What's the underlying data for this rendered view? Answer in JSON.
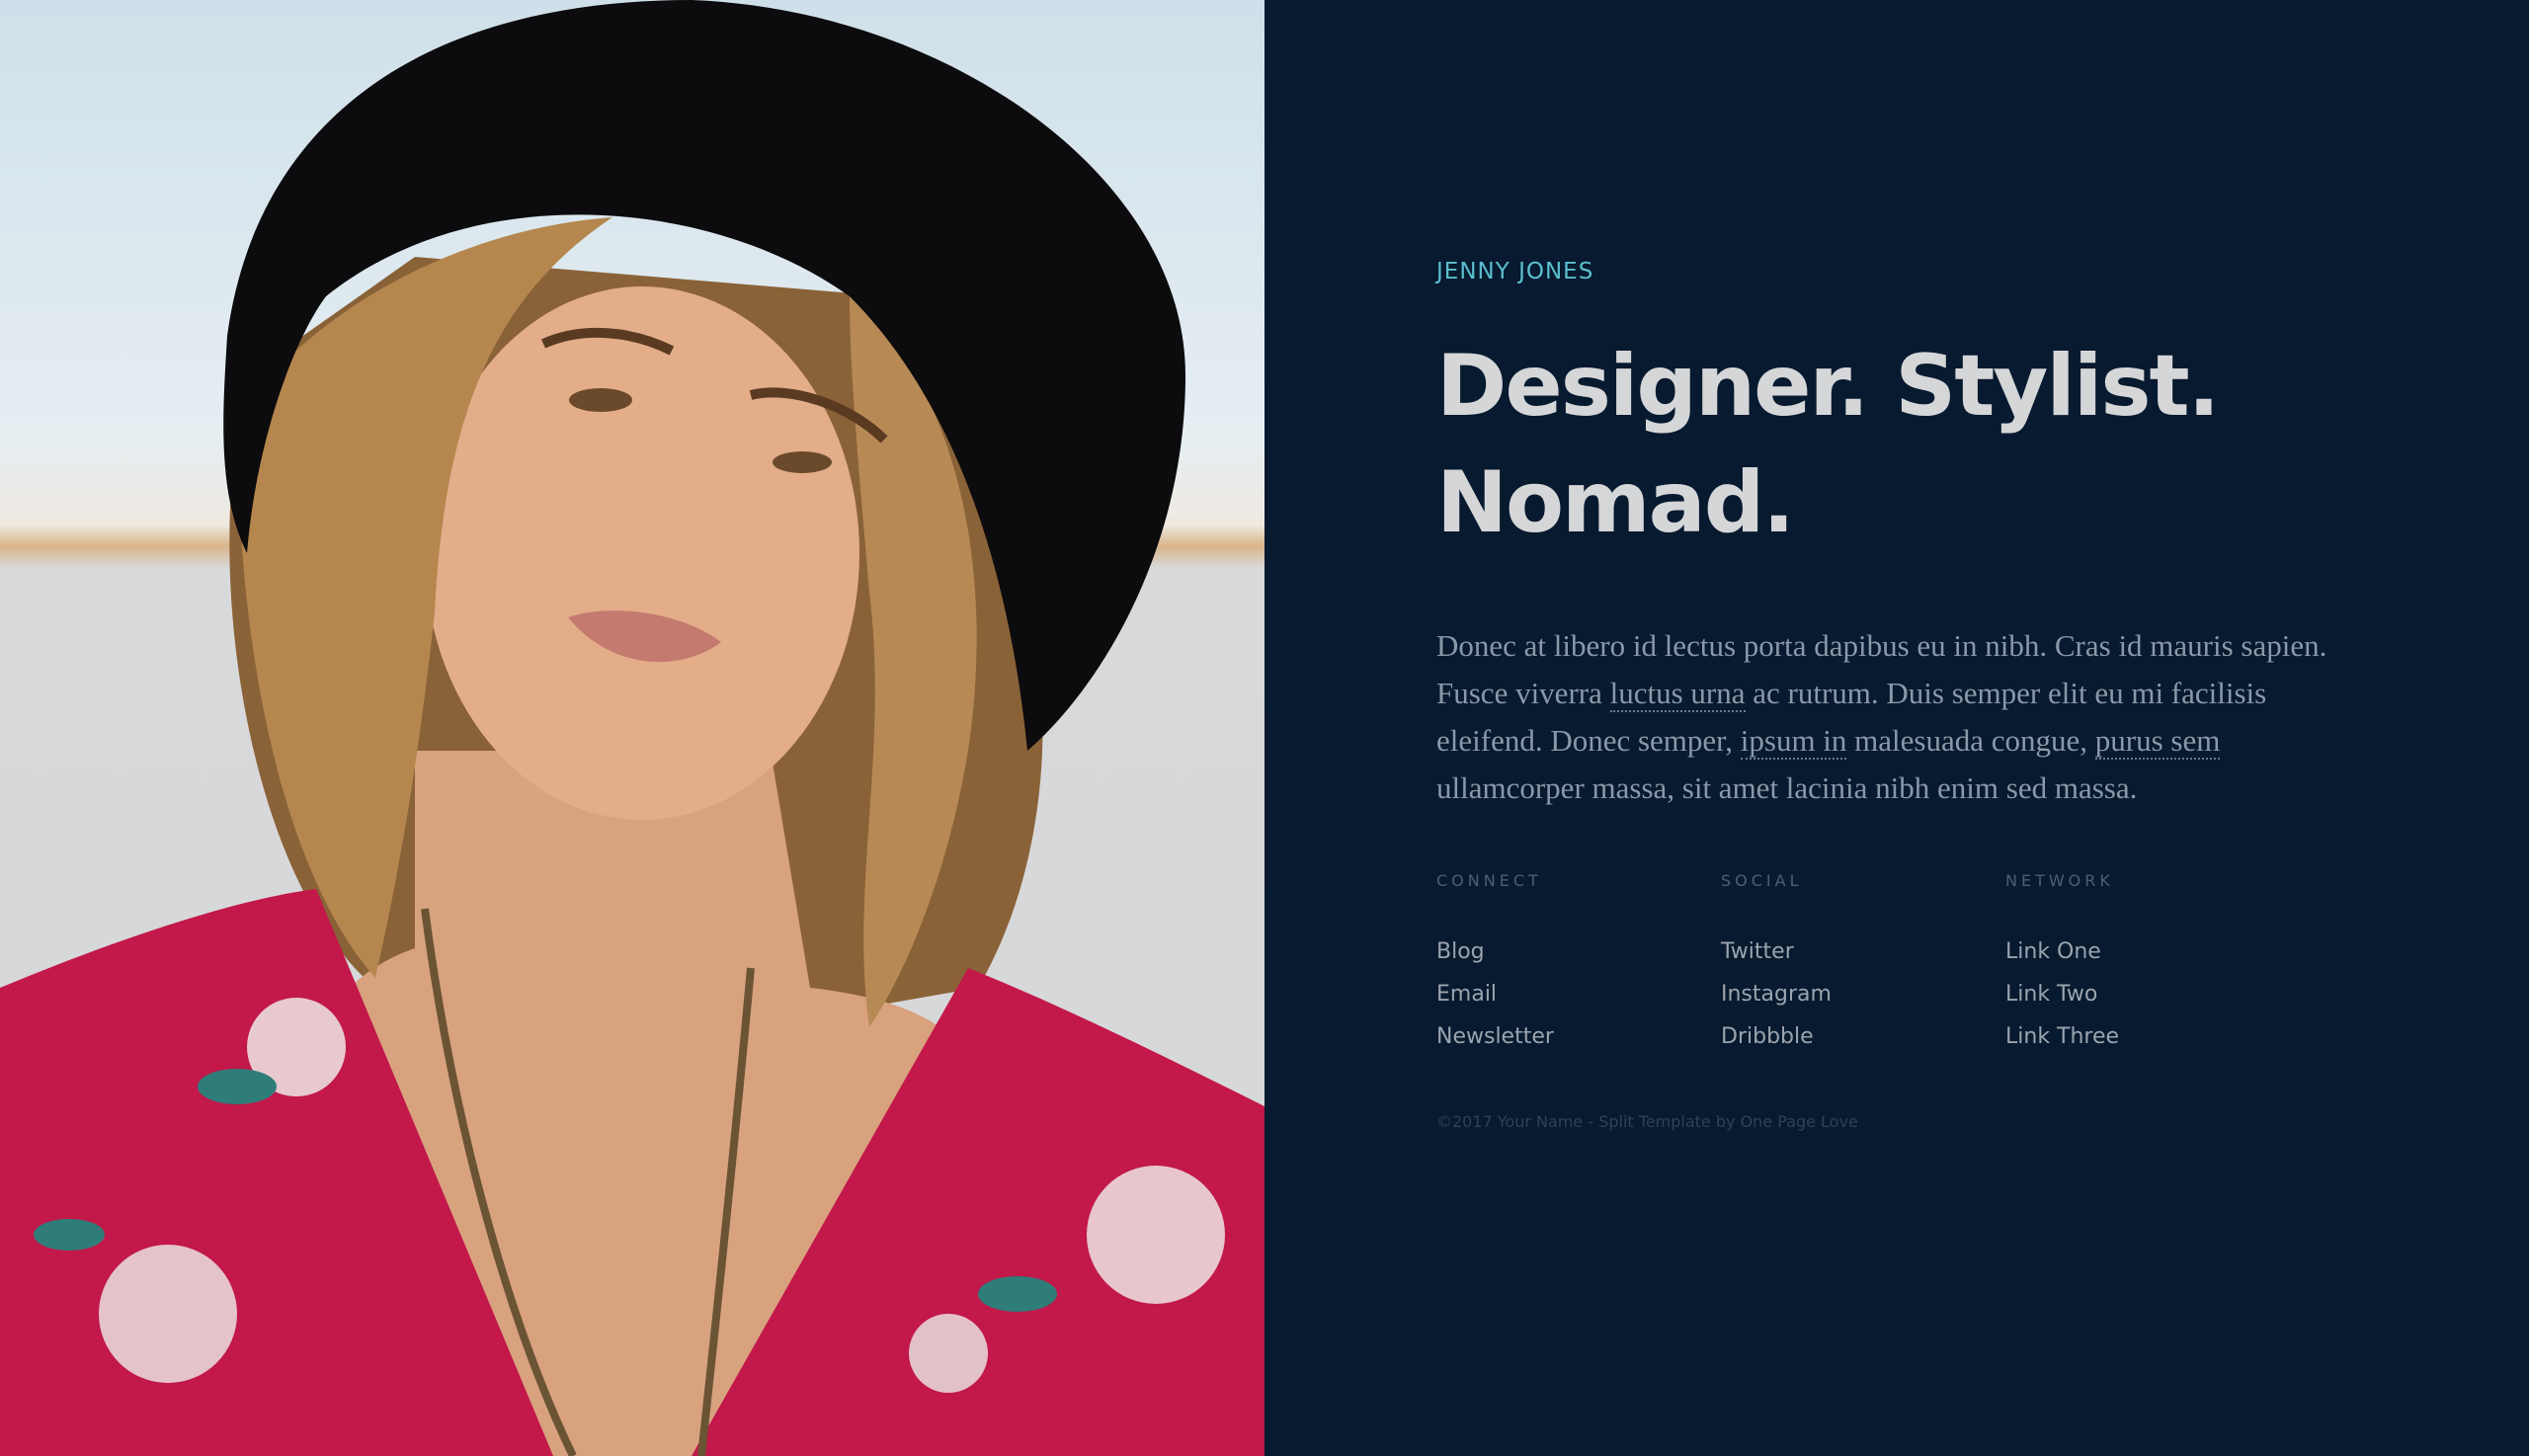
{
  "hero_image": {
    "alt": "Portrait of a woman wearing a black hat and red floral top"
  },
  "profile": {
    "name": "JENNY JONES",
    "headline_line1": "Designer. Stylist.",
    "headline_line2": "Nomad.",
    "accent_color": "#5bbfcf"
  },
  "bio": {
    "segments": [
      {
        "text": "Donec at libero id lectus porta dapibus eu in nibh. Cras id mauris sapien. Fusce viverra ",
        "link": false
      },
      {
        "text": "luctus urna",
        "link": true
      },
      {
        "text": " ac rutrum. Duis semper elit eu mi facilisis eleifend. Donec semper, ",
        "link": false
      },
      {
        "text": "ipsum in",
        "link": true
      },
      {
        "text": " malesuada congue, ",
        "link": false
      },
      {
        "text": "purus sem",
        "link": true
      },
      {
        "text": " ullamcorper massa, sit amet lacinia nibh enim sed massa.",
        "link": false
      }
    ]
  },
  "link_columns": [
    {
      "heading": "CONNECT",
      "links": [
        "Blog",
        "Email",
        "Newsletter"
      ]
    },
    {
      "heading": "SOCIAL",
      "links": [
        "Twitter",
        "Instagram",
        "Dribbble"
      ]
    },
    {
      "heading": "NETWORK",
      "links": [
        "Link One",
        "Link Two",
        "Link Three"
      ]
    }
  ],
  "footer": {
    "copyright": "©2017 Your Name - Split Template by One Page Love"
  },
  "colors": {
    "background": "#071a2f",
    "headline": "#d5d6d8",
    "body_text": "#8a98a8"
  }
}
